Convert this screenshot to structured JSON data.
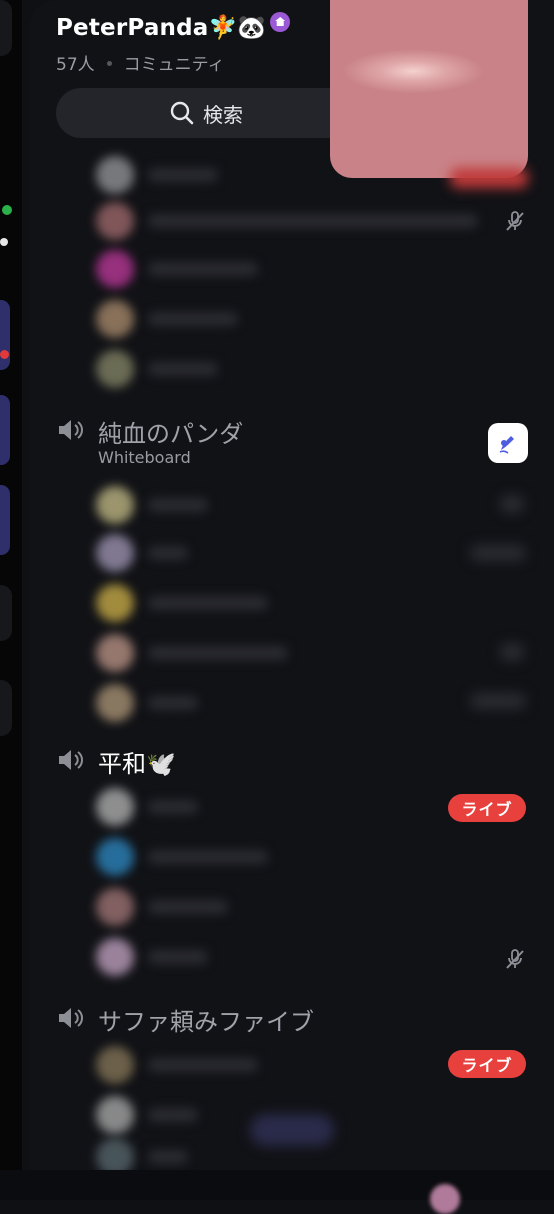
{
  "server": {
    "name": "PeterPanda",
    "emoji": "🧚🐼",
    "member_count": "57人",
    "category": "コミュニティ"
  },
  "search": {
    "label": "検索"
  },
  "channels": [
    {
      "name": "純血のパンダ",
      "activity": "Whiteboard"
    },
    {
      "name": "平和🕊️"
    },
    {
      "name": "サファ頼みファイブ"
    }
  ],
  "badges": {
    "live": "ライブ"
  },
  "icons": {
    "search": "magnifier-icon",
    "voice": "speaker-icon",
    "muted": "mic-muted-icon",
    "home": "home-icon",
    "activity": "hand-draw-icon"
  },
  "colors": {
    "background": "#111216",
    "live": "#e8413d",
    "accent": "#9b59d6"
  }
}
